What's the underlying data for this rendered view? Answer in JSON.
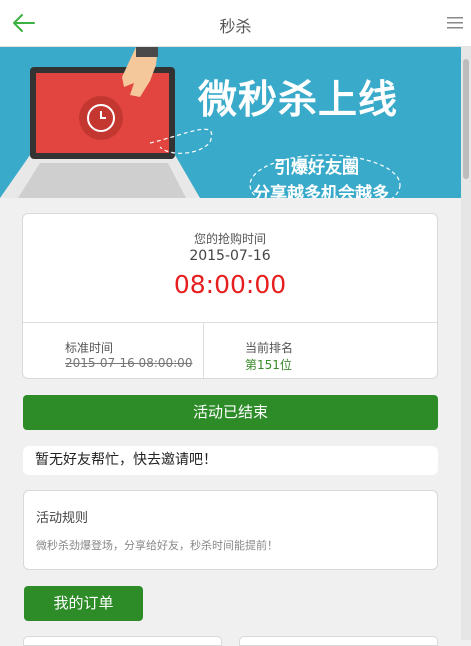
{
  "header": {
    "title": "秒杀",
    "back_icon": "back-arrow-icon",
    "menu_icon": "hamburger-menu-icon",
    "accent_color": "#3cb043"
  },
  "banner": {
    "headline": "微秒杀上线",
    "line1": "引爆好友圈",
    "line2": "分享越多机会越多"
  },
  "time_card": {
    "label": "您的抢购时间",
    "date": "2015-07-16",
    "time": "08:00:00",
    "standard_label": "标准时间",
    "standard_value": "2015-07-16 08:00:00",
    "rank_label": "当前排名",
    "rank_prefix": "第",
    "rank_number": "151",
    "rank_suffix": "位"
  },
  "actions": {
    "ended_label": "活动已结束",
    "orders_label": "我的订单"
  },
  "notice": {
    "text": "暂无好友帮忙，快去邀请吧！"
  },
  "rules": {
    "title": "活动规则",
    "text": "微秒杀劲爆登场，分享给好友，秒杀时间能提前！"
  },
  "colors": {
    "primary_green": "#2d8c28",
    "time_red": "#e61e1e",
    "banner_blue": "#39aac9"
  }
}
